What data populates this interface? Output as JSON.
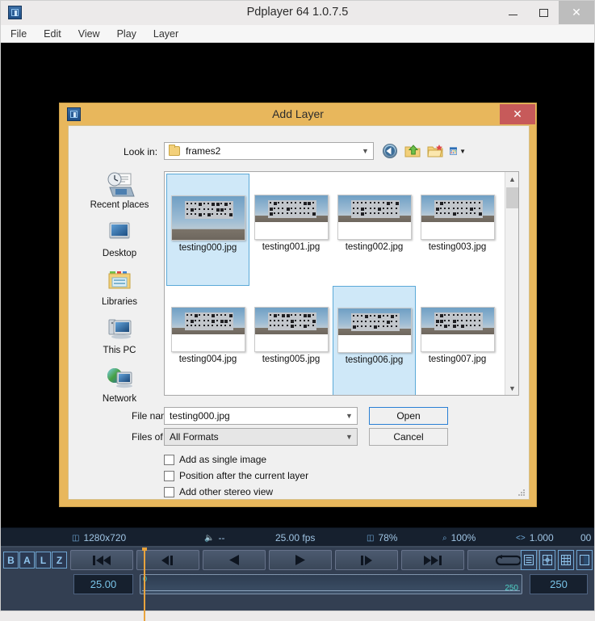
{
  "app": {
    "title": "Pdplayer 64 1.0.7.5",
    "icon": "pdplayer-icon",
    "window_buttons": [
      {
        "name": "minimize",
        "glyph": "–"
      },
      {
        "name": "maximize",
        "glyph": "□"
      },
      {
        "name": "close",
        "glyph": "✕"
      }
    ],
    "menu": [
      "File",
      "Edit",
      "View",
      "Play",
      "Layer"
    ]
  },
  "statusbar": {
    "resolution": "1280x720",
    "audio": "--",
    "fps": "25.00 fps",
    "zoom_fit": "78%",
    "zoom": "100%",
    "gamma": "1.000",
    "frame": "00"
  },
  "transport": {
    "channel_buttons": [
      "B",
      "A",
      "L",
      "Z"
    ],
    "buttons": [
      {
        "name": "go-to-start-button",
        "glyph": "first"
      },
      {
        "name": "step-back-button",
        "glyph": "prev-step"
      },
      {
        "name": "play-backward-button",
        "glyph": "play-back"
      },
      {
        "name": "play-forward-button",
        "glyph": "play"
      },
      {
        "name": "step-forward-button",
        "glyph": "next-step"
      },
      {
        "name": "go-to-end-button",
        "glyph": "last"
      },
      {
        "name": "loop-button",
        "glyph": "loop"
      }
    ],
    "right_buttons": [
      "list-view-icon",
      "center-view-icon",
      "grid-view-icon",
      "compare-view-icon"
    ],
    "fps_value": "25.00",
    "end_frame": "250",
    "range_start": "0",
    "range_end": "250"
  },
  "dialog": {
    "title": "Add Layer",
    "close_glyph": "✕",
    "lookin": {
      "label": "Look in:",
      "value": "frames2",
      "arrow": "⌄"
    },
    "nav_icons": [
      "back-icon",
      "up-folder-icon",
      "new-folder-icon",
      "view-mode-icon"
    ],
    "places": [
      {
        "name": "recent-places",
        "label": "Recent places"
      },
      {
        "name": "desktop",
        "label": "Desktop"
      },
      {
        "name": "libraries",
        "label": "Libraries"
      },
      {
        "name": "this-pc",
        "label": "This PC"
      },
      {
        "name": "network",
        "label": "Network"
      }
    ],
    "files": [
      {
        "name": "testing000.jpg",
        "selected": true,
        "full": true
      },
      {
        "name": "testing001.jpg",
        "selected": false,
        "full": false
      },
      {
        "name": "testing002.jpg",
        "selected": false,
        "full": false
      },
      {
        "name": "testing003.jpg",
        "selected": false,
        "full": false
      },
      {
        "name": "testing004.jpg",
        "selected": false,
        "full": false
      },
      {
        "name": "testing005.jpg",
        "selected": false,
        "full": false
      },
      {
        "name": "testing006.jpg",
        "selected": true,
        "full": false
      },
      {
        "name": "testing007.jpg",
        "selected": false,
        "full": false
      }
    ],
    "form": {
      "filename_label": "File name:",
      "filename_value": "testing000.jpg",
      "filetype_label": "Files of type:",
      "filetype_value": "All Formats",
      "open_label": "Open",
      "cancel_label": "Cancel"
    },
    "checkboxes": [
      {
        "name": "add-as-single-image",
        "label": "Add as single image",
        "checked": false
      },
      {
        "name": "position-after-current-layer",
        "label": "Position after the current layer",
        "checked": false
      },
      {
        "name": "add-other-stereo-view",
        "label": "Add other stereo view",
        "checked": false
      }
    ]
  },
  "colors": {
    "dialog_chrome": "#e8b75c",
    "close_red": "#c75a5a",
    "selection_blue": "#cfe8f8",
    "status_bg": "#16202e",
    "transport_bg": "#333f52",
    "accent_cyan": "#79c4e8"
  }
}
